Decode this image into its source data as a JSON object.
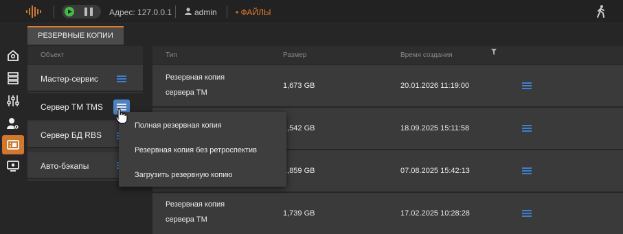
{
  "topbar": {
    "address": "Адрес: 127.0.0.1",
    "user": "admin",
    "files_link": "• ФАЙЛЫ",
    "accent": "#e07a2a"
  },
  "tab": {
    "label": "РЕЗЕРВНЫЕ КОПИИ"
  },
  "sidebar": {
    "icons": [
      "home-icon",
      "servers-icon",
      "sliders-icon",
      "user-settings-icon",
      "backup-icon",
      "monitor-icon"
    ],
    "active_index": 4
  },
  "objects": {
    "header": "Объект",
    "items": [
      {
        "label": "Мастер-сервис"
      },
      {
        "label": "Сервер ТМ TMS"
      },
      {
        "label": "Сервер БД RBS"
      },
      {
        "label": "Авто-бэкапы"
      }
    ],
    "selected_index": 1
  },
  "table": {
    "columns": [
      "Тип",
      "Размер",
      "Время создания"
    ],
    "rows": [
      {
        "type_line1": "Резервная копия",
        "type_line2": "сервера ТМ",
        "size": "1,673 GB",
        "created": "20.01.2026 11:19:00"
      },
      {
        "type_line1": "",
        "type_line2": "",
        "size": "1,542 GB",
        "created": "18.09.2025 15:11:58"
      },
      {
        "type_line1": "",
        "type_line2": "",
        "size": "1,859 GB",
        "created": "07.08.2025 15:42:13"
      },
      {
        "type_line1": "Резервная копия",
        "type_line2": "сервера ТМ",
        "size": "1,739 GB",
        "created": "17.02.2025 10:28:28"
      }
    ]
  },
  "context_menu": {
    "items": [
      {
        "label": "Полная резервная копия"
      },
      {
        "label": "Резервная копия без ретроспектив"
      },
      {
        "label": "Загрузить резервную копию"
      }
    ]
  }
}
